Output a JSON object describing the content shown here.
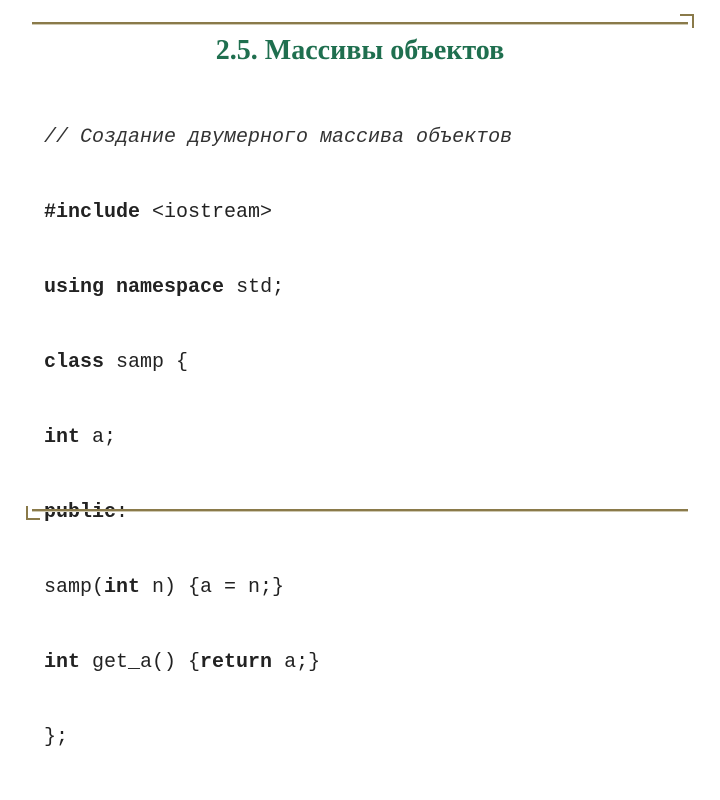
{
  "title": "2.5. Массивы объектов",
  "code": {
    "l0": {
      "comment": "// Создание двумерного массива объектов"
    },
    "l1": {
      "kw": "#include",
      "rest": " <iostream>"
    },
    "l2": {
      "kw1": "using",
      "kw2": "namespace",
      "rest": " std;"
    },
    "l3": {
      "kw": "class",
      "rest": " samp {"
    },
    "l4": {
      "kw": "int",
      "rest": " a;"
    },
    "l5": {
      "kw": "public",
      "rest": ":"
    },
    "l6": {
      "a": "samp(",
      "kw": "int",
      "b": " n) {a = n;}"
    },
    "l7": {
      "kw1": "int",
      "mid": " get_a() {",
      "kw2": "return",
      "b": " a;}"
    },
    "l8": {
      "rest": "};"
    }
  }
}
